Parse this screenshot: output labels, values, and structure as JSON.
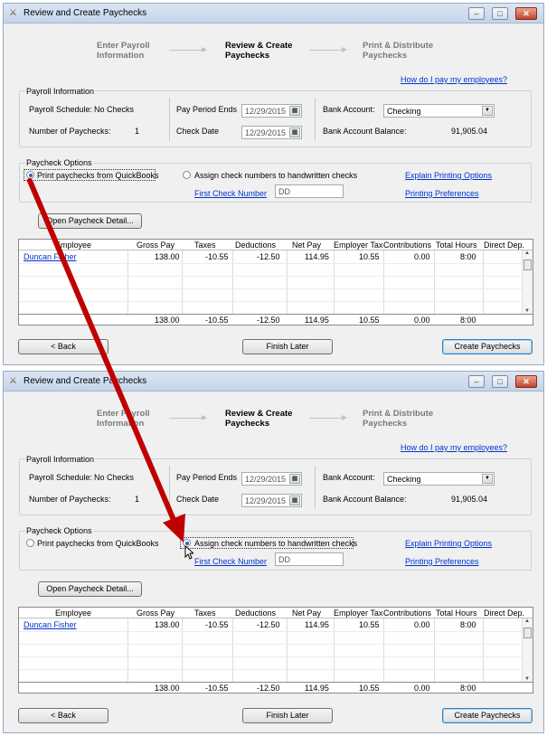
{
  "window": {
    "title": "Review and Create Paychecks"
  },
  "steps": [
    {
      "l1": "Enter Payroll",
      "l2": "Information"
    },
    {
      "l1": "Review & Create",
      "l2": "Paychecks"
    },
    {
      "l1": "Print & Distribute",
      "l2": "Paychecks"
    }
  ],
  "help_link": "How do I pay my employees?",
  "payroll_info": {
    "title": "Payroll Information",
    "schedule_label": "Payroll Schedule:",
    "schedule_value": "No Checks",
    "num_label": "Number of Paychecks:",
    "num_value": "1",
    "period_label": "Pay Period Ends",
    "period_value": "12/29/2015",
    "check_date_label": "Check Date",
    "check_date_value": "12/29/2015",
    "bank_label": "Bank Account:",
    "bank_value": "Checking",
    "balance_label": "Bank Account Balance:",
    "balance_value": "91,905.04"
  },
  "options": {
    "title": "Paycheck Options",
    "print_label": "Print paychecks from QuickBooks",
    "assign_label": "Assign check numbers to handwritten checks",
    "first_check_label": "First Check Number",
    "first_check_value": "DD",
    "explain_link": "Explain Printing Options",
    "prefs_link": "Printing Preferences"
  },
  "detail_button": "Open Paycheck Detail...",
  "table": {
    "headers": [
      "Employee",
      "Gross Pay",
      "Taxes",
      "Deductions",
      "Net Pay",
      "Employer Taxes",
      "Contributions",
      "Total Hours",
      "Direct Dep."
    ],
    "row": [
      "Duncan Fisher",
      "138.00",
      "-10.55",
      "-12.50",
      "114.95",
      "10.55",
      "0.00",
      "8:00",
      ""
    ],
    "totals": [
      "",
      "138.00",
      "-10.55",
      "-12.50",
      "114.95",
      "10.55",
      "0.00",
      "8:00",
      ""
    ]
  },
  "buttons": {
    "back": "< Back",
    "finish_later": "Finish Later",
    "create": "Create Paychecks"
  },
  "window_controls": {
    "minimize": "–",
    "restore": "□",
    "close": "✕"
  },
  "colors": {
    "arrow": "#c00000",
    "link": "#0033cc"
  }
}
